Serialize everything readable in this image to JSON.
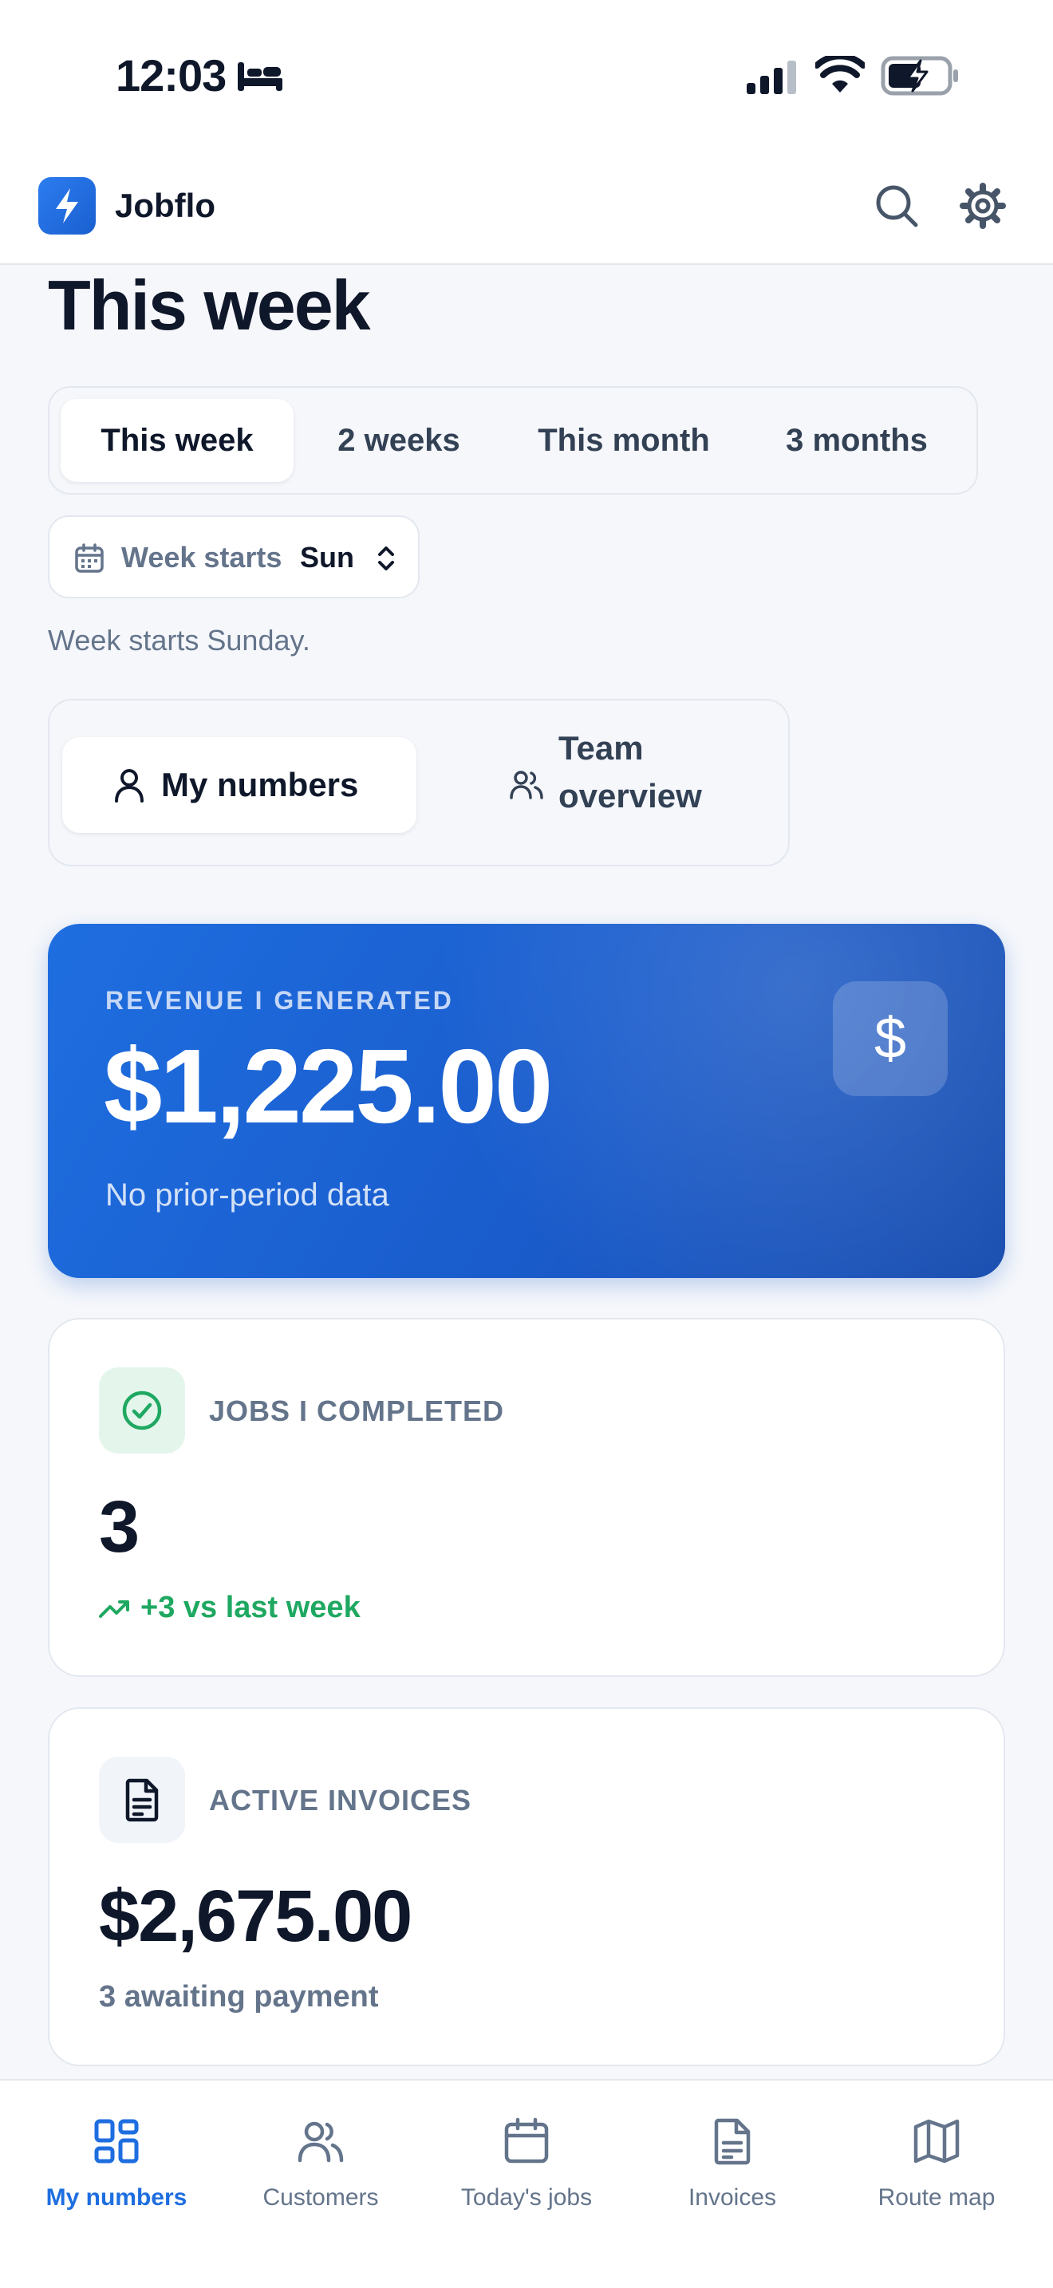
{
  "status_bar": {
    "time": "12:03"
  },
  "app": {
    "name": "Jobflo"
  },
  "page": {
    "title": "This week"
  },
  "range_options": [
    {
      "label": "This week",
      "selected": true
    },
    {
      "label": "2 weeks",
      "selected": false
    },
    {
      "label": "This month",
      "selected": false
    },
    {
      "label": "3 months",
      "selected": false
    }
  ],
  "week_start": {
    "label": "Week starts",
    "value": "Sun",
    "hint": "Week starts Sunday."
  },
  "scope": {
    "options": [
      {
        "label": "My numbers",
        "selected": true
      },
      {
        "label": "Team overview",
        "selected": false
      }
    ]
  },
  "revenue_card": {
    "label": "REVENUE I GENERATED",
    "value": "$1,225.00",
    "subtitle": "No prior-period data",
    "icon": "$"
  },
  "jobs_card": {
    "label": "JOBS I COMPLETED",
    "value": "3",
    "trend": "+3 vs last week"
  },
  "invoices_card": {
    "label": "ACTIVE INVOICES",
    "value": "$2,675.00",
    "subtitle": "3 awaiting payment"
  },
  "tabbar": {
    "items": [
      {
        "label": "My numbers",
        "icon": "dashboard-icon",
        "active": true
      },
      {
        "label": "Customers",
        "icon": "users-icon",
        "active": false
      },
      {
        "label": "Today's jobs",
        "icon": "calendar-icon",
        "active": false
      },
      {
        "label": "Invoices",
        "icon": "document-icon",
        "active": false
      },
      {
        "label": "Route map",
        "icon": "map-icon",
        "active": false
      }
    ]
  },
  "colors": {
    "accent": "#1e6ee0",
    "success": "#1fa861",
    "background": "#f5f7fb"
  }
}
